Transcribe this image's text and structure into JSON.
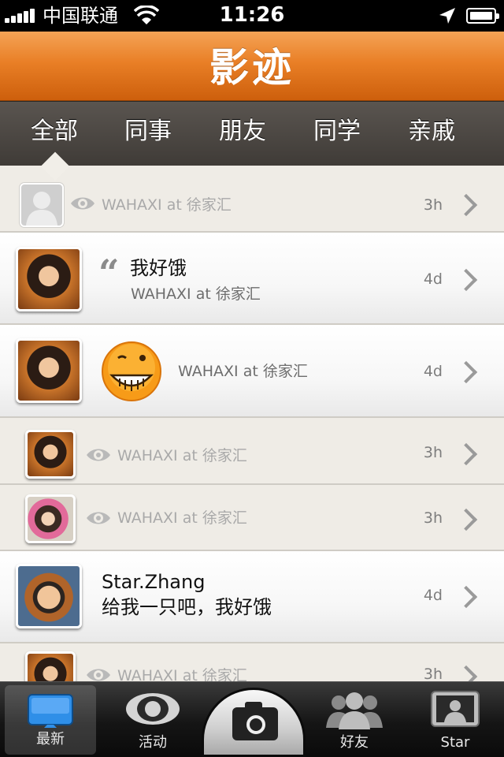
{
  "status_bar": {
    "carrier": "中国联通",
    "time": "11:26"
  },
  "header": {
    "logo": "影迹"
  },
  "tabs": [
    {
      "label": "全部",
      "selected": true
    },
    {
      "label": "同事",
      "selected": false
    },
    {
      "label": "朋友",
      "selected": false
    },
    {
      "label": "同学",
      "selected": false
    },
    {
      "label": "亲戚",
      "selected": false
    }
  ],
  "feed": [
    {
      "meta": "WAHAXI at 徐家汇",
      "age": "3h"
    },
    {
      "title": "我好饿",
      "meta": "WAHAXI at 徐家汇",
      "age": "4d"
    },
    {
      "meta": "WAHAXI at 徐家汇",
      "age": "4d"
    },
    {
      "meta": "WAHAXI at 徐家汇",
      "age": "3h"
    },
    {
      "meta": "WAHAXI at 徐家汇",
      "age": "3h"
    },
    {
      "name": "Star.Zhang",
      "message": "给我一只吧，我好饿",
      "age": "4d"
    },
    {
      "meta": "WAHAXI at 徐家汇",
      "age": "3h"
    }
  ],
  "tab_bar": {
    "items": [
      {
        "label": "最新",
        "icon": "monitor-icon",
        "active": true
      },
      {
        "label": "活动",
        "icon": "eye-icon",
        "active": false
      },
      {
        "label": "",
        "icon": "camera-icon",
        "active": false
      },
      {
        "label": "好友",
        "icon": "people-icon",
        "active": false
      },
      {
        "label": "Star",
        "icon": "profile-icon",
        "active": false
      }
    ]
  },
  "colors": {
    "header_orange": "#e97f26",
    "tab_bg": "#4a4540",
    "list_bg": "#efece6",
    "blue_icon": "#2f8fe8"
  }
}
